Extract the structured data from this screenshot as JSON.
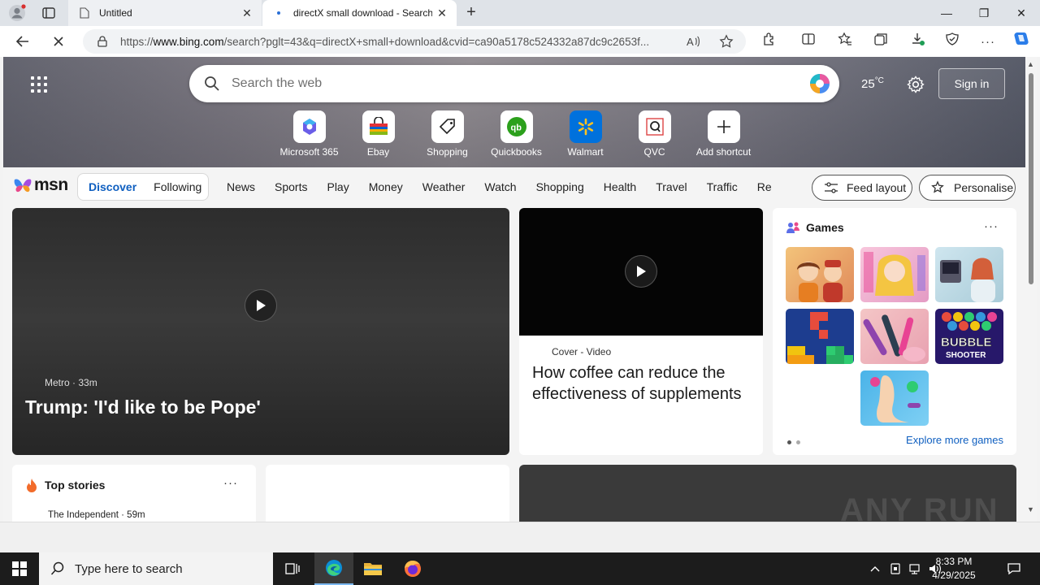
{
  "browser": {
    "tabs": [
      {
        "title": "Untitled",
        "close": "✕"
      },
      {
        "title": "directX small download - Search",
        "close": "✕"
      }
    ],
    "new_tab": "+",
    "window_controls": {
      "minimize": "—",
      "restore": "❐",
      "close": "✕"
    },
    "url_prefix": "https://",
    "url_domain": "www.bing.com",
    "url_rest": "/search?pglt=43&q=directX+small+download&cvid=ca90a5178c524332a87dc9c2653f...",
    "more": "···"
  },
  "hero": {
    "search_placeholder": "Search the web",
    "temperature": "25",
    "temperature_unit": "°C",
    "signin": "Sign in",
    "shortcuts": [
      {
        "label": "Microsoft 365",
        "icon": "microsoft365-icon"
      },
      {
        "label": "Ebay",
        "icon": "ebay-icon"
      },
      {
        "label": "Shopping",
        "icon": "shopping-tag-icon"
      },
      {
        "label": "Quickbooks",
        "icon": "quickbooks-icon"
      },
      {
        "label": "Walmart",
        "icon": "walmart-icon"
      },
      {
        "label": "QVC",
        "icon": "qvc-icon"
      },
      {
        "label": "Add shortcut",
        "icon": "plus-icon"
      }
    ]
  },
  "msn": {
    "logo": "msn",
    "discover": "Discover",
    "following": "Following",
    "nav": [
      "News",
      "Sports",
      "Play",
      "Money",
      "Weather",
      "Watch",
      "Shopping",
      "Health",
      "Travel",
      "Traffic",
      "Real Estate"
    ],
    "feed_layout": "Feed layout",
    "personalise": "Personalise"
  },
  "cards": {
    "main": {
      "source": "Metro",
      "time": "33m",
      "headline": "Trump: 'I'd like to be Pope'"
    },
    "video": {
      "source": "Cover - Video",
      "title": "How coffee can reduce the effectiveness of supplements"
    },
    "games": {
      "title": "Games",
      "more": "···",
      "explore": "Explore more games",
      "bubble_line1": "BUBBLE",
      "bubble_line2": "SHOOTER"
    },
    "top_stories": {
      "title": "Top stories",
      "more": "···",
      "source": "The Independent · 59m"
    }
  },
  "watermark": "ANY RUN",
  "taskbar": {
    "search_placeholder": "Type here to search",
    "time": "8:33 PM",
    "date": "4/29/2025"
  },
  "colors": {
    "accent": "#0f5fc0",
    "taskbar": "#1c1c1c"
  }
}
